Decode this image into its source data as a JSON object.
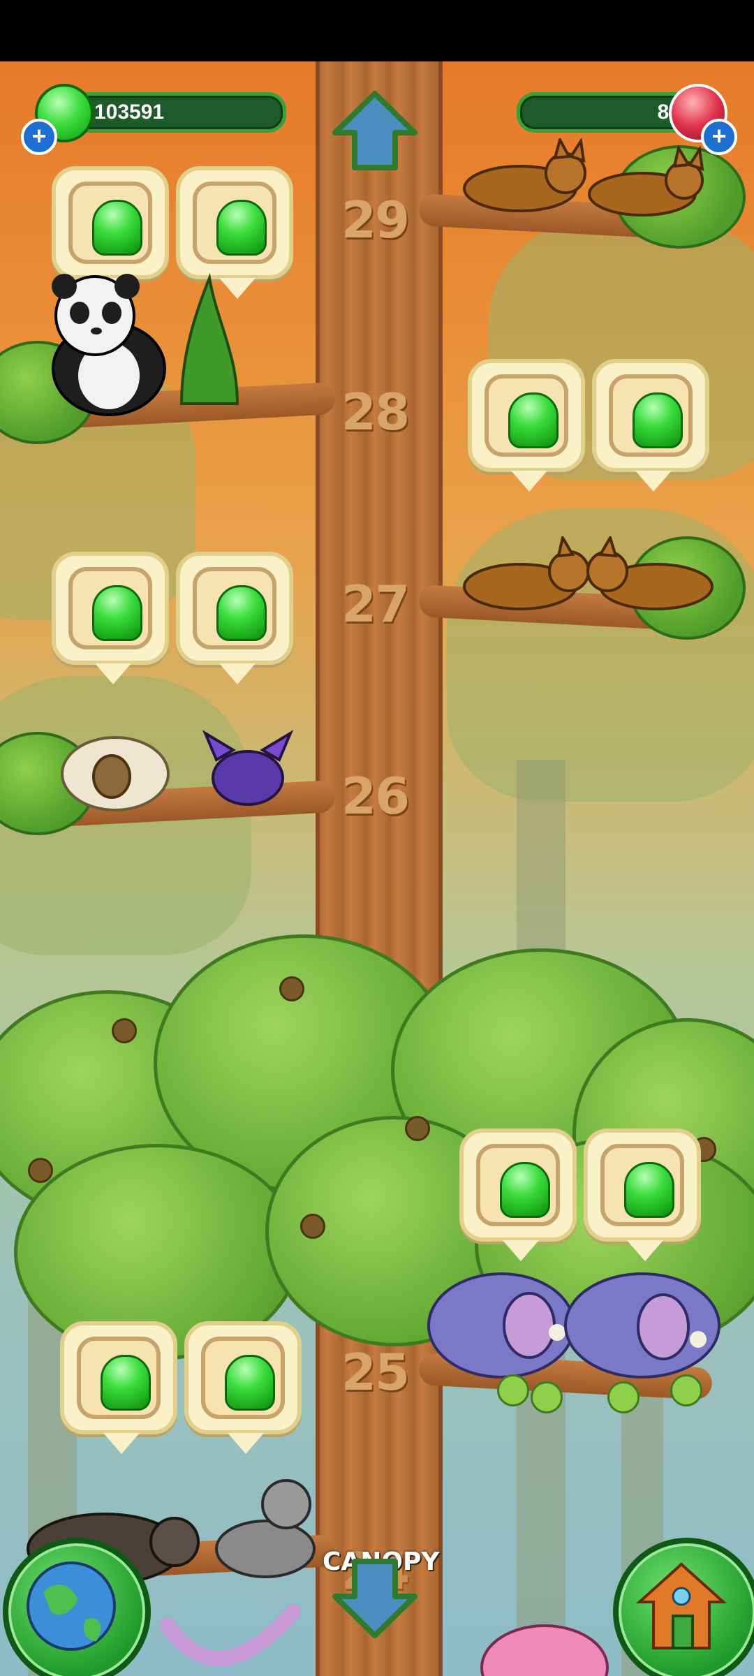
{
  "hud": {
    "jelly_count": "103591",
    "gem_count": "80",
    "jelly_plus": "+",
    "gem_plus": "+"
  },
  "floors": [
    "29",
    "28",
    "27",
    "26",
    "25",
    "24"
  ],
  "canopy_label": "CANOPY",
  "icons": {
    "up": "up-arrow-icon",
    "down": "down-arrow-icon",
    "map": "globe-icon",
    "home": "house-icon"
  },
  "colors": {
    "jelly_green": "#3bdc3b",
    "hud_bar": "#1f5a2a",
    "gem_red": "#e0314b",
    "plus_blue": "#1d6fd1"
  }
}
